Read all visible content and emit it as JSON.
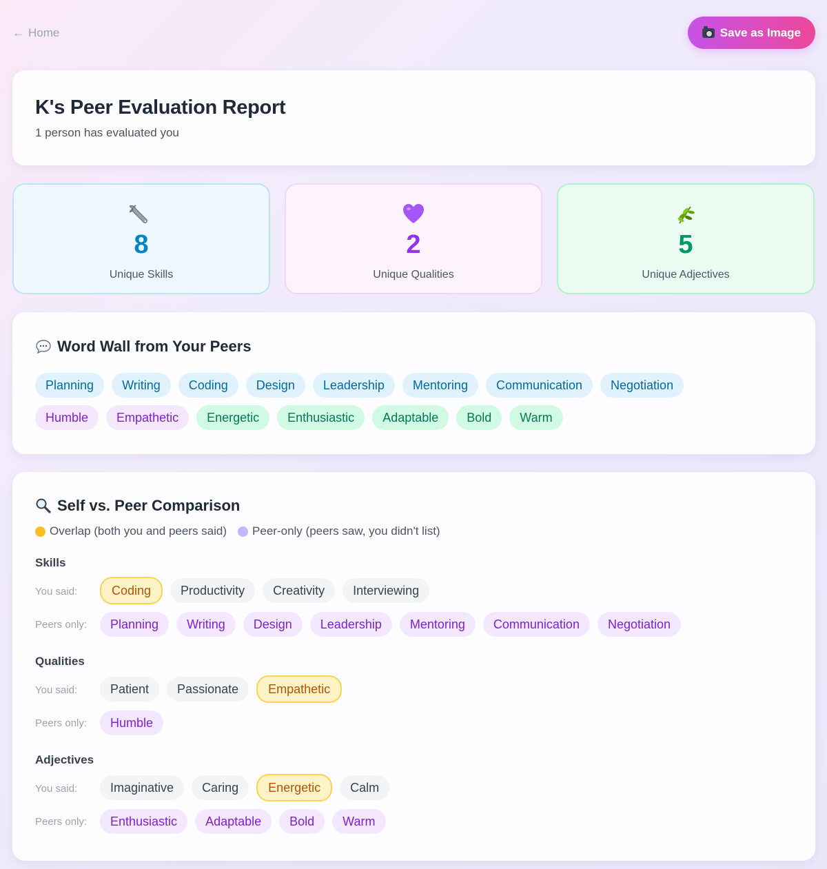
{
  "nav": {
    "home_label": "Home",
    "save_label": "Save as Image"
  },
  "header": {
    "title": "K's Peer Evaluation Report",
    "subtitle": "1 person has evaluated you"
  },
  "stats": [
    {
      "icon": "wrench-icon",
      "value": "8",
      "label": "Unique Skills"
    },
    {
      "icon": "purple-heart-icon",
      "value": "2",
      "label": "Unique Qualities"
    },
    {
      "icon": "herb-icon",
      "value": "5",
      "label": "Unique Adjectives"
    }
  ],
  "word_wall": {
    "title": "Word Wall from Your Peers",
    "skills": [
      "Planning",
      "Writing",
      "Coding",
      "Design",
      "Leadership",
      "Mentoring",
      "Communication",
      "Negotiation"
    ],
    "qualities": [
      "Humble",
      "Empathetic"
    ],
    "adjectives": [
      "Energetic",
      "Enthusiastic",
      "Adaptable",
      "Bold",
      "Warm"
    ]
  },
  "comparison": {
    "title": "Self vs. Peer Comparison",
    "legend_overlap": "Overlap (both you and peers said)",
    "legend_peer": "Peer-only (peers saw, you didn't list)",
    "you_said_label": "You said:",
    "peers_only_label": "Peers only:",
    "groups": [
      {
        "title": "Skills",
        "you_said": [
          {
            "text": "Coding",
            "overlap": true
          },
          {
            "text": "Productivity",
            "overlap": false
          },
          {
            "text": "Creativity",
            "overlap": false
          },
          {
            "text": "Interviewing",
            "overlap": false
          }
        ],
        "peers_only": [
          "Planning",
          "Writing",
          "Design",
          "Leadership",
          "Mentoring",
          "Communication",
          "Negotiation"
        ]
      },
      {
        "title": "Qualities",
        "you_said": [
          {
            "text": "Patient",
            "overlap": false
          },
          {
            "text": "Passionate",
            "overlap": false
          },
          {
            "text": "Empathetic",
            "overlap": true
          }
        ],
        "peers_only": [
          "Humble"
        ]
      },
      {
        "title": "Adjectives",
        "you_said": [
          {
            "text": "Imaginative",
            "overlap": false
          },
          {
            "text": "Caring",
            "overlap": false
          },
          {
            "text": "Energetic",
            "overlap": true
          },
          {
            "text": "Calm",
            "overlap": false
          }
        ],
        "peers_only": [
          "Enthusiastic",
          "Adaptable",
          "Bold",
          "Warm"
        ]
      }
    ]
  },
  "colors": {
    "accent_start": "#c653e8",
    "accent_end": "#ec4899",
    "overlap": "#fbbf24",
    "peer": "#c4b5fd"
  }
}
